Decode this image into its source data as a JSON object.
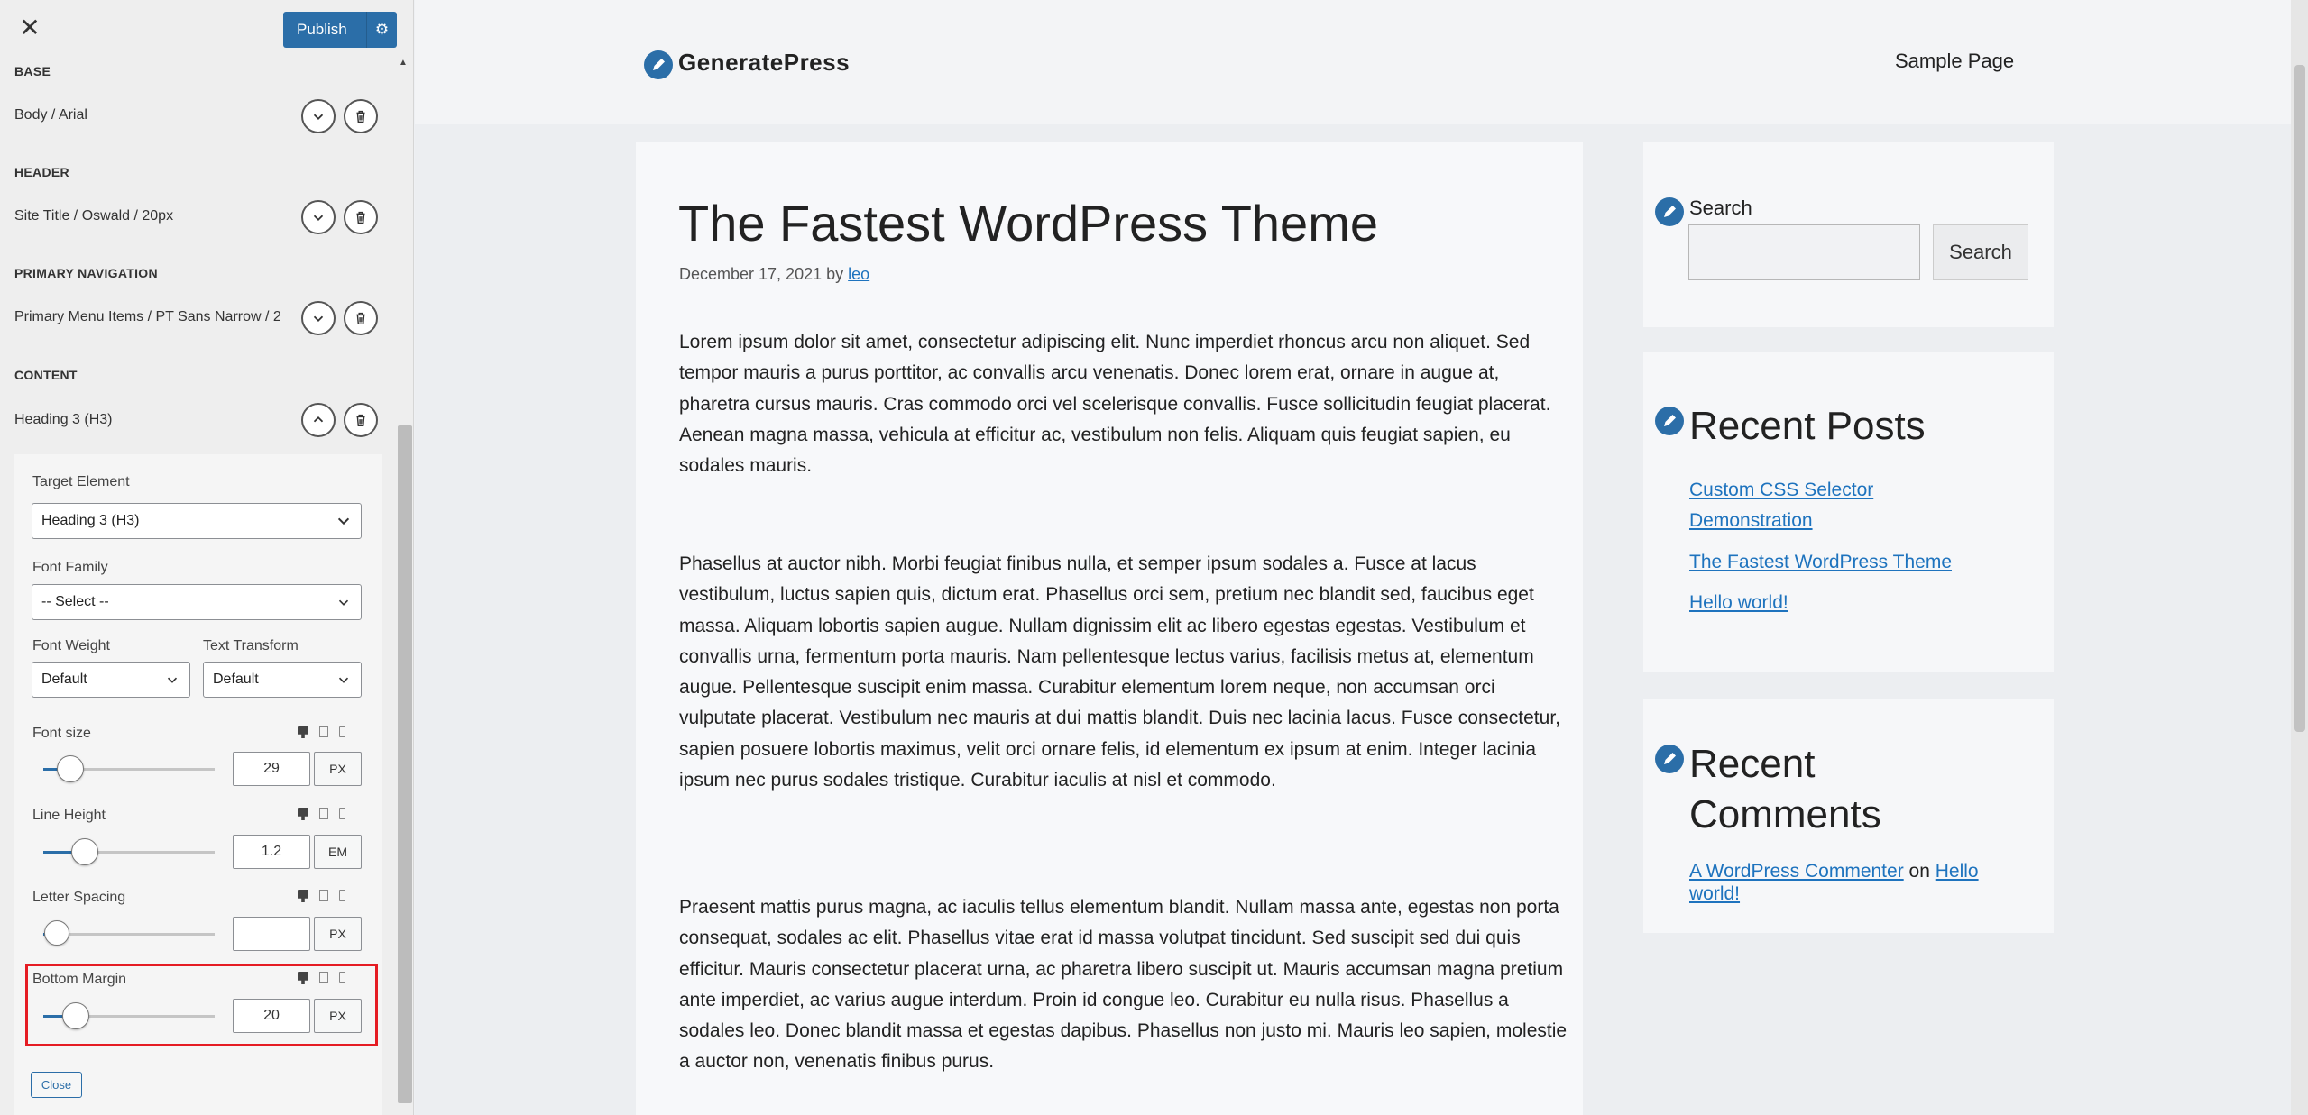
{
  "customizer": {
    "close_icon": "close-x-icon",
    "publish_label": "Publish",
    "sections": {
      "base": {
        "title": "BASE",
        "item": "Body / Arial"
      },
      "header": {
        "title": "HEADER",
        "item": "Site Title / Oswald / 20px"
      },
      "primary_navigation": {
        "title": "PRIMARY NAVIGATION",
        "item": "Primary Menu Items / PT Sans Narrow / 2"
      },
      "content": {
        "title": "CONTENT",
        "item": "Heading 3 (H3)"
      }
    },
    "panel": {
      "target_element": {
        "label": "Target Element",
        "value": "Heading 3 (H3)"
      },
      "font_family": {
        "label": "Font Family",
        "value": "-- Select --"
      },
      "font_weight": {
        "label": "Font Weight",
        "value": "Default"
      },
      "text_transform": {
        "label": "Text Transform",
        "value": "Default"
      },
      "font_size": {
        "label": "Font size",
        "value": "29",
        "unit": "PX",
        "slider_fraction": 0.16
      },
      "line_height": {
        "label": "Line Height",
        "value": "1.2",
        "unit": "EM",
        "slider_fraction": 0.24
      },
      "letter_spacing": {
        "label": "Letter Spacing",
        "value": "",
        "unit": "PX",
        "slider_fraction": 0.08
      },
      "bottom_margin": {
        "label": "Bottom Margin",
        "value": "20",
        "unit": "PX",
        "slider_fraction": 0.19
      },
      "close_label": "Close"
    },
    "accent_color": "#2b6ea8",
    "highlight_color": "#e51c23"
  },
  "preview": {
    "site_title": "GeneratePress",
    "nav": [
      "Sample Page"
    ],
    "post": {
      "title": "The Fastest WordPress Theme",
      "date": "December 17, 2021",
      "by": "by",
      "author": "leo",
      "paragraphs": [
        "Lorem ipsum dolor sit amet, consectetur adipiscing elit. Nunc imperdiet rhoncus arcu non aliquet. Sed tempor mauris a purus porttitor, ac convallis arcu venenatis. Donec lorem erat, ornare in augue at, pharetra cursus mauris. Cras commodo orci vel scelerisque convallis. Fusce sollicitudin feugiat placerat. Aenean magna massa, vehicula at efficitur ac, vestibulum non felis. Aliquam quis feugiat sapien, eu sodales mauris.",
        "Phasellus at auctor nibh. Morbi feugiat finibus nulla, et semper ipsum sodales a. Fusce at lacus vestibulum, luctus sapien quis, dictum erat. Phasellus orci sem, pretium nec blandit sed, faucibus eget massa. Aliquam lobortis sapien augue. Nullam dignissim elit ac libero egestas egestas. Vestibulum et convallis urna, fermentum porta mauris. Nam pellentesque lectus varius, facilisis metus at, elementum augue. Pellentesque suscipit enim massa. Curabitur elementum lorem neque, non accumsan orci vulputate placerat. Vestibulum nec mauris at dui mattis blandit. Duis nec lacinia lacus. Fusce consectetur, sapien posuere lobortis maximus, velit orci ornare felis, id elementum ex ipsum at enim. Integer lacinia ipsum nec purus sodales tristique. Curabitur iaculis at nisl et commodo.",
        "Praesent mattis purus magna, ac iaculis tellus elementum blandit. Nullam massa ante, egestas non porta consequat, sodales ac elit. Phasellus vitae erat id massa volutpat tincidunt. Sed suscipit sed dui quis efficitur. Mauris consectetur placerat urna, ac pharetra libero suscipit ut. Mauris accumsan magna pretium ante imperdiet, ac varius augue interdum. Proin id congue leo. Curabitur eu nulla risus. Phasellus a sodales leo. Donec blandit massa et egestas dapibus. Phasellus non justo mi. Mauris leo sapien, molestie a auctor non, venenatis finibus purus."
      ]
    },
    "sidebar": {
      "search_label": "Search",
      "search_button": "Search",
      "recent_posts_title": "Recent Posts",
      "recent_posts": [
        "Custom CSS Selector Demonstration",
        "The Fastest WordPress Theme",
        "Hello world!"
      ],
      "recent_comments_title": "Recent Comments",
      "comment": {
        "author": "A WordPress Commenter",
        "on": "on",
        "post": "Hello world!"
      }
    },
    "link_color": "#1e73be"
  }
}
